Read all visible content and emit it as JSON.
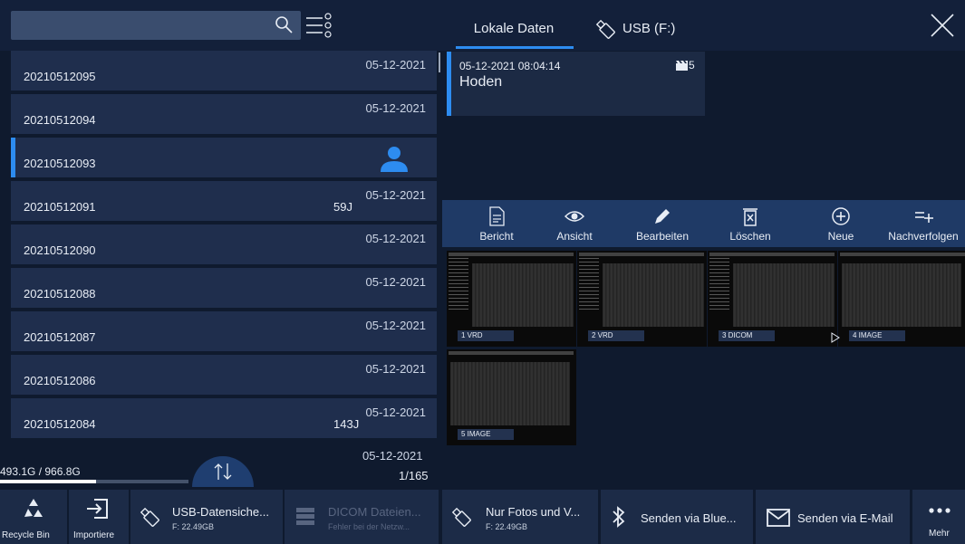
{
  "header": {
    "search_placeholder": "",
    "tabs": [
      {
        "label": "Lokale Daten",
        "active": true
      },
      {
        "label": "USB (F:)",
        "active": false
      }
    ]
  },
  "exam_list": {
    "rows": [
      {
        "id": "20210512095",
        "date": "05-12-2021",
        "age": "",
        "selected": false
      },
      {
        "id": "20210512094",
        "date": "05-12-2021",
        "age": "",
        "selected": false
      },
      {
        "id": "20210512093",
        "date": "",
        "age": "",
        "selected": true,
        "icon": "user-icon"
      },
      {
        "id": "20210512091",
        "date": "05-12-2021",
        "age": "59J",
        "selected": false
      },
      {
        "id": "20210512090",
        "date": "05-12-2021",
        "age": "",
        "selected": false
      },
      {
        "id": "20210512088",
        "date": "05-12-2021",
        "age": "",
        "selected": false
      },
      {
        "id": "20210512087",
        "date": "05-12-2021",
        "age": "",
        "selected": false
      },
      {
        "id": "20210512086",
        "date": "05-12-2021",
        "age": "",
        "selected": false
      },
      {
        "id": "20210512084",
        "date": "05-12-2021",
        "age": "143J",
        "selected": false
      }
    ],
    "last_partial_date": "05-12-2021",
    "storage": "493.1G / 966.8G",
    "storage_used_fraction": 0.51,
    "page_count": "1/165"
  },
  "exam_card": {
    "datetime": "05-12-2021 08:04:14",
    "title": "Hoden",
    "clip_count": "5"
  },
  "toolbar": {
    "items": [
      {
        "label": "Bericht",
        "icon": "report-icon"
      },
      {
        "label": "Ansicht",
        "icon": "eye-icon"
      },
      {
        "label": "Bearbeiten",
        "icon": "pencil-icon"
      },
      {
        "label": "Löschen",
        "icon": "delete-icon"
      },
      {
        "label": "Neue",
        "icon": "plus-circle-icon"
      },
      {
        "label": "Nachverfolgen",
        "icon": "follow-up-icon"
      }
    ]
  },
  "images": [
    {
      "label": "1   VRD"
    },
    {
      "label": "2   VRD"
    },
    {
      "label": "3   DICOM"
    },
    {
      "label": "4   IMAGE"
    },
    {
      "label": "5   IMAGE"
    }
  ],
  "bottom_bar": {
    "recycle_bin": "Recycle Bin",
    "import": "Importiere",
    "usb_backup": {
      "label": "USB-Datensiche...",
      "sub": "F: 22.49GB"
    },
    "dicom": {
      "label": "DICOM Dateien...",
      "sub": "Fehler bei der Netzw..."
    },
    "photos_only": {
      "label": "Nur Fotos und V...",
      "sub": "F: 22.49GB"
    },
    "bluetooth": "Senden via Blue...",
    "email": "Senden via E-Mail",
    "more": "Mehr"
  },
  "colors": {
    "accent": "#2d8cf0",
    "panel": "#1f2e4d",
    "background": "#0f1a2e"
  }
}
